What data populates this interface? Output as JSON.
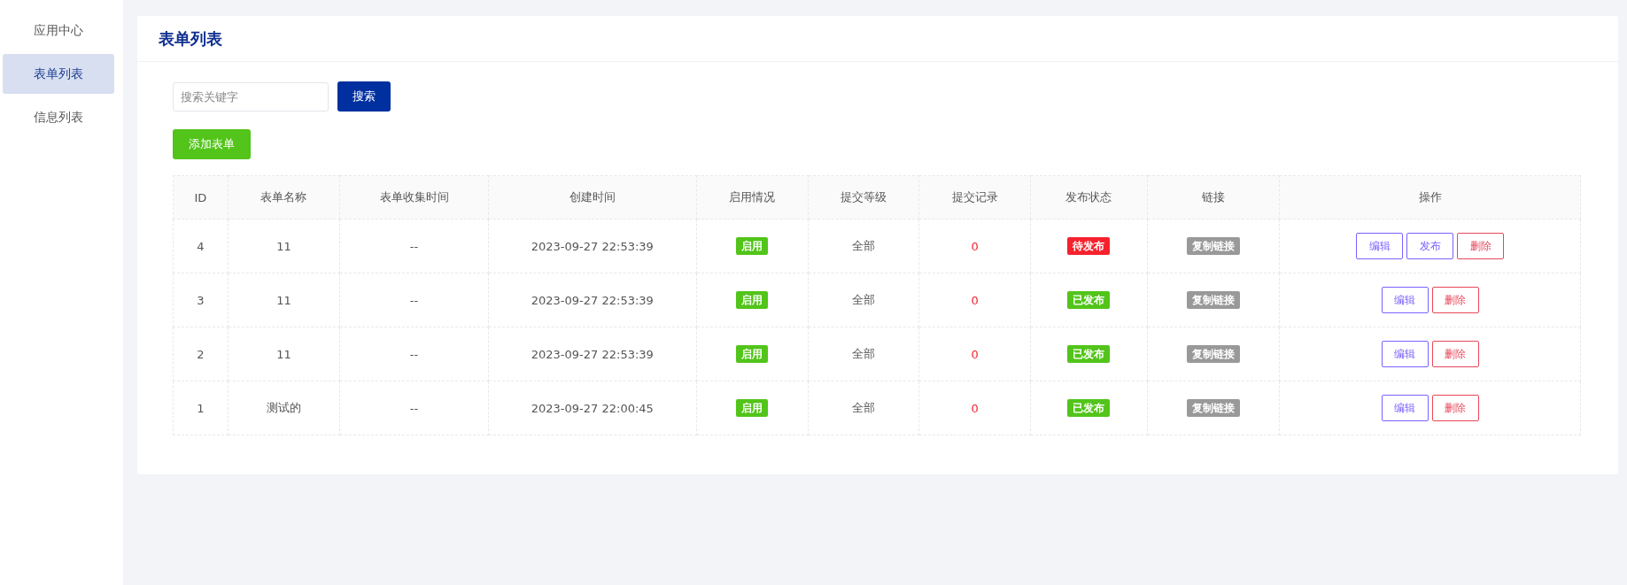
{
  "sidebar": {
    "items": [
      {
        "label": "应用中心",
        "selected": false
      },
      {
        "label": "表单列表",
        "selected": true
      },
      {
        "label": "信息列表",
        "selected": false
      }
    ]
  },
  "page": {
    "title": "表单列表"
  },
  "search": {
    "placeholder": "搜索关键字",
    "button": "搜索"
  },
  "add_button": "添加表单",
  "table": {
    "columns": [
      "ID",
      "表单名称",
      "表单收集时间",
      "创建时间",
      "启用情况",
      "提交等级",
      "提交记录",
      "发布状态",
      "链接",
      "操作"
    ],
    "rows": [
      {
        "id": "4",
        "name": "11",
        "collect_time": "--",
        "created": "2023-09-27 22:53:39",
        "enabled": {
          "label": "启用",
          "on": true
        },
        "level": "全部",
        "records": "0",
        "publish": {
          "label": "待发布",
          "kind": "pending"
        },
        "link": "复制链接",
        "actions": [
          {
            "label": "编辑",
            "kind": "edit"
          },
          {
            "label": "发布",
            "kind": "publish"
          },
          {
            "label": "删除",
            "kind": "delete"
          }
        ]
      },
      {
        "id": "3",
        "name": "11",
        "collect_time": "--",
        "created": "2023-09-27 22:53:39",
        "enabled": {
          "label": "启用",
          "on": true
        },
        "level": "全部",
        "records": "0",
        "publish": {
          "label": "已发布",
          "kind": "published"
        },
        "link": "复制链接",
        "actions": [
          {
            "label": "编辑",
            "kind": "edit"
          },
          {
            "label": "删除",
            "kind": "delete"
          }
        ]
      },
      {
        "id": "2",
        "name": "11",
        "collect_time": "--",
        "created": "2023-09-27 22:53:39",
        "enabled": {
          "label": "启用",
          "on": true
        },
        "level": "全部",
        "records": "0",
        "publish": {
          "label": "已发布",
          "kind": "published"
        },
        "link": "复制链接",
        "actions": [
          {
            "label": "编辑",
            "kind": "edit"
          },
          {
            "label": "删除",
            "kind": "delete"
          }
        ]
      },
      {
        "id": "1",
        "name": "测试的",
        "collect_time": "--",
        "created": "2023-09-27 22:00:45",
        "enabled": {
          "label": "启用",
          "on": true
        },
        "level": "全部",
        "records": "0",
        "publish": {
          "label": "已发布",
          "kind": "published"
        },
        "link": "复制链接",
        "actions": [
          {
            "label": "编辑",
            "kind": "edit"
          },
          {
            "label": "删除",
            "kind": "delete"
          }
        ]
      }
    ]
  }
}
